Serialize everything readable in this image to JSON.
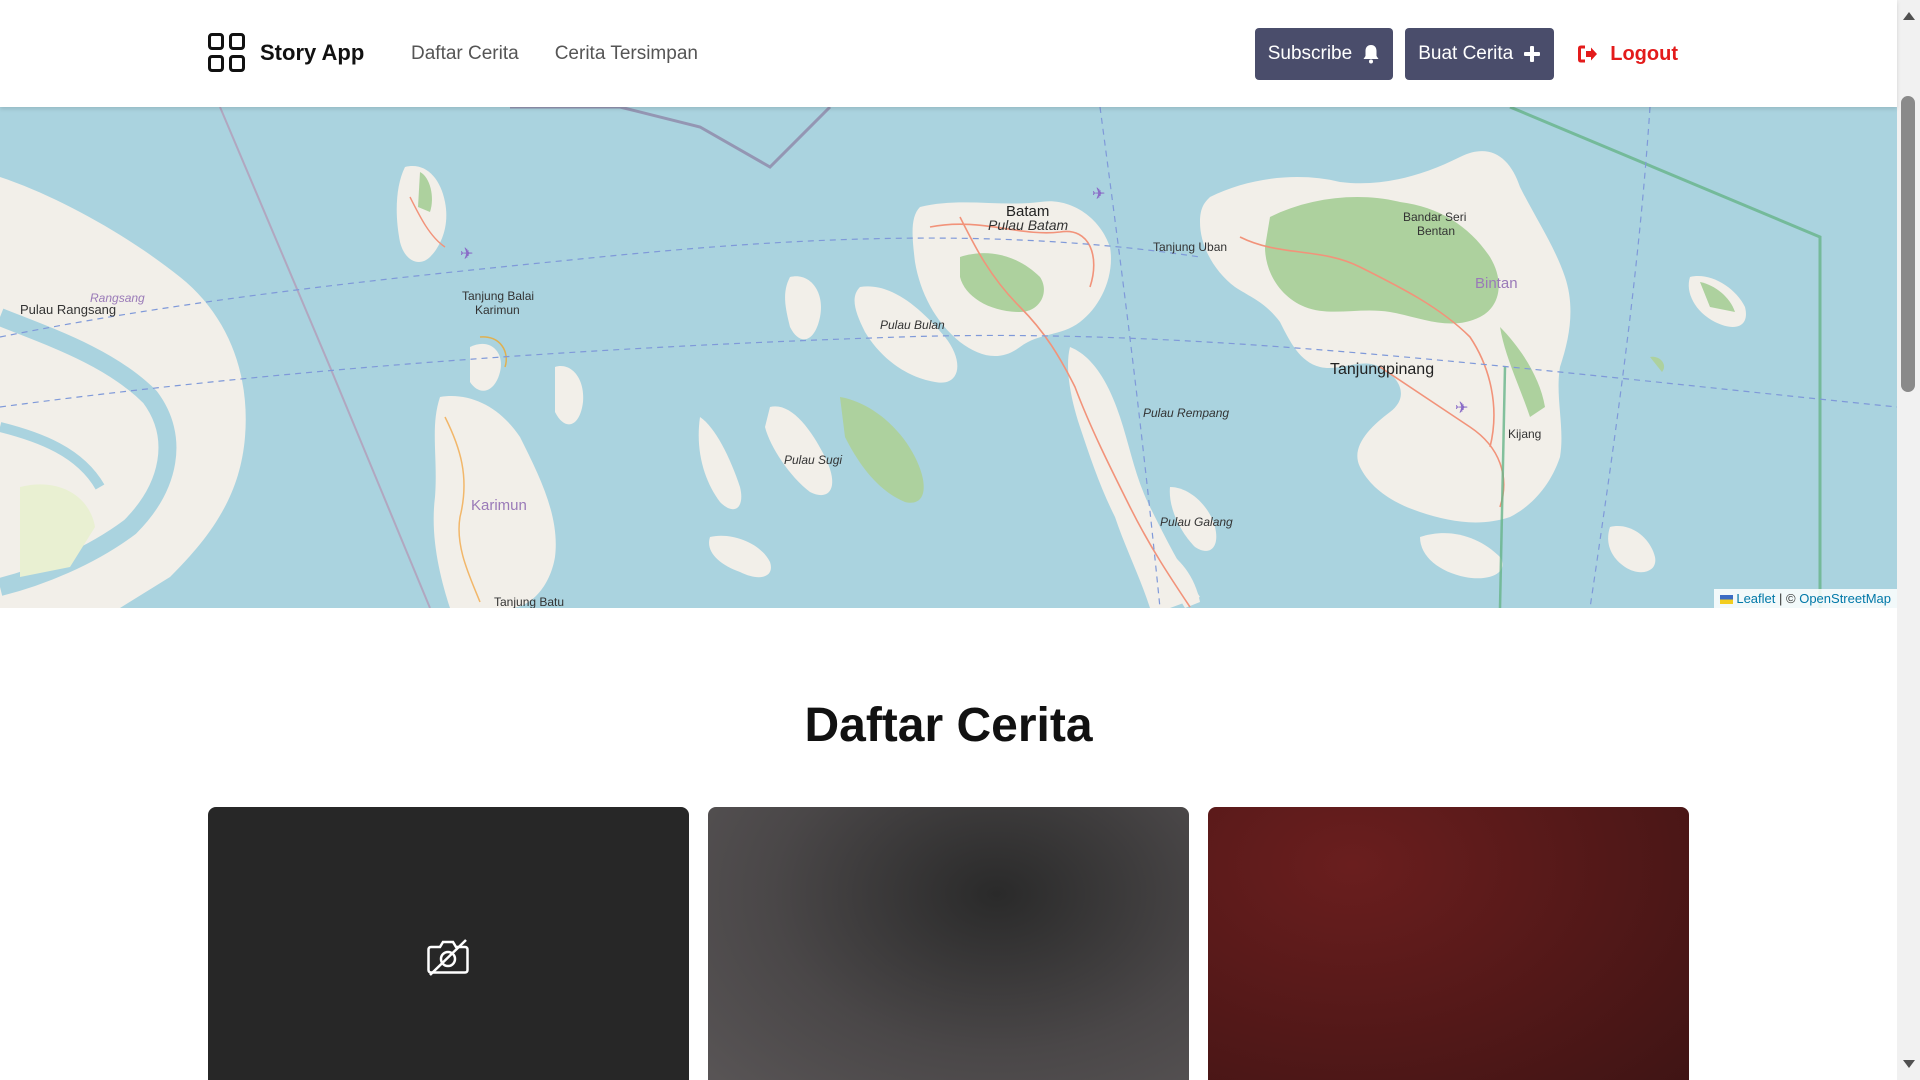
{
  "header": {
    "brand": "Story App",
    "nav": [
      "Daftar Cerita",
      "Cerita Tersimpan"
    ],
    "subscribe_label": "Subscribe",
    "create_label": "Buat Cerita",
    "logout_label": "Logout"
  },
  "map": {
    "labels": {
      "rangsang": "Rangsang",
      "pulau_rangsang": "Pulau Rangsang",
      "tanjung_balai_1": "Tanjung Balai",
      "tanjung_balai_2": "Karimun",
      "batam": "Batam",
      "pulau_batam": "Pulau Batam",
      "tanjung_uban": "Tanjung Uban",
      "bandar_seri_1": "Bandar Seri",
      "bandar_seri_2": "Bentan",
      "bintan": "Bintan",
      "pulau_bulan": "Pulau Bulan",
      "tanjungpinang": "Tanjungpinang",
      "pulau_rempang": "Pulau Rempang",
      "kijang": "Kijang",
      "pulau_sugi": "Pulau Sugi",
      "karimun": "Karimun",
      "pulau_galang": "Pulau Galang",
      "tanjung_batu": "Tanjung Batu"
    },
    "attribution": {
      "leaflet": "Leaflet",
      "separator": "| ©",
      "osm": "OpenStreetMap"
    }
  },
  "main": {
    "title": "Daftar Cerita"
  },
  "colors": {
    "sea": "#aad3df",
    "land": "#f2efe9",
    "forest": "#add19e",
    "button": "#4a4d6b",
    "logout": "#e31b1b"
  },
  "icons": {
    "brand": "grid-icon",
    "subscribe": "bell-icon",
    "create": "plus-icon",
    "logout": "sign-out-icon",
    "no_image": "camera-off-icon"
  }
}
